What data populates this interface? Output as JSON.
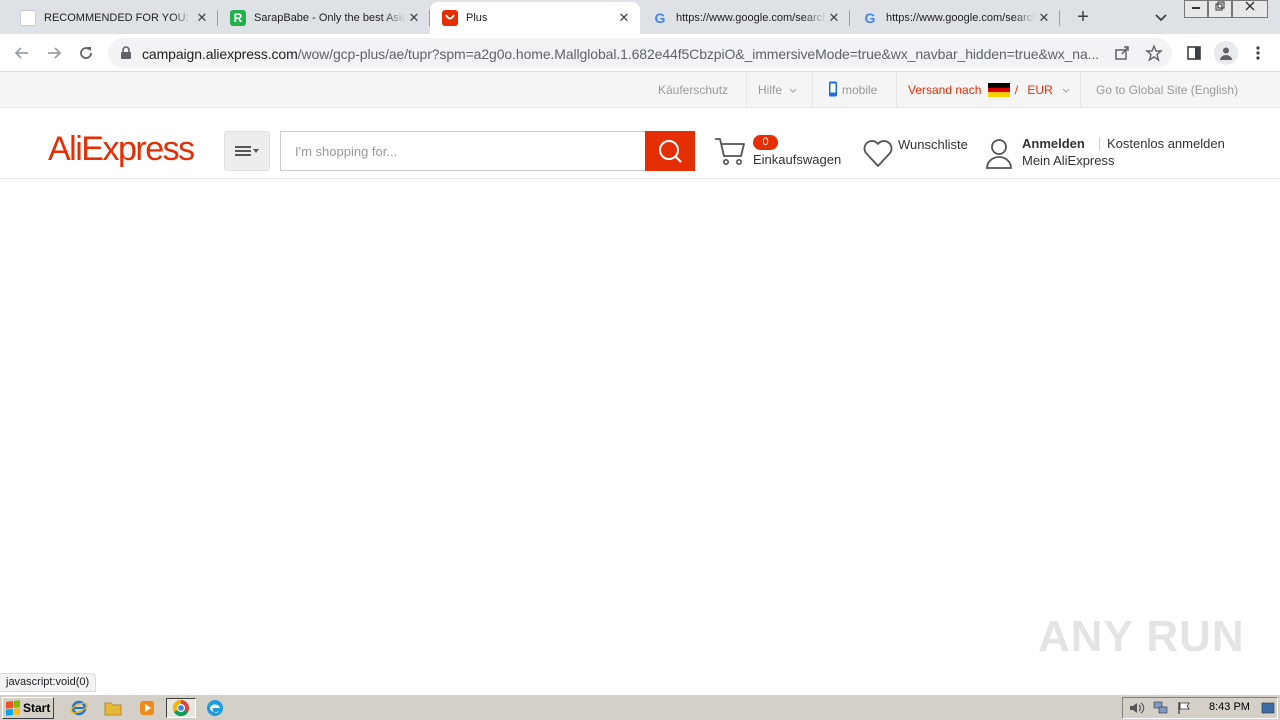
{
  "browser": {
    "tabs": [
      {
        "title": "RECOMMENDED FOR YOU:",
        "favicon": "blank-page-icon"
      },
      {
        "title": "SarapBabe - Only the best Asian",
        "favicon": "r-logo-icon"
      },
      {
        "title": "Plus",
        "favicon": "aliexpress-icon",
        "active": true
      },
      {
        "title": "https://www.google.com/search",
        "favicon": "google-icon"
      },
      {
        "title": "https://www.google.com/search",
        "favicon": "google-icon"
      }
    ],
    "close_glyph": "✕",
    "new_tab_glyph": "+",
    "url_host": "campaign.aliexpress.com",
    "url_rest": "/wow/gcp-plus/ae/tupr?spm=a2g0o.home.Mallglobal.1.682e44f5CbzpiO&_immersiveMode=true&wx_navbar_hidden=true&wx_na..."
  },
  "topbar": {
    "buyer_protection": "Käuferschutz",
    "help": "Hilfe",
    "mobile": "mobile",
    "ship_to": "Versand nach",
    "slash": "/",
    "currency": "EUR",
    "global_site": "Go to Global Site (English)"
  },
  "header": {
    "logo": "AliExpress",
    "search_placeholder": "I'm shopping for...",
    "cart_count": "0",
    "cart_label": "Einkaufswagen",
    "wishlist_label": "Wunschliste",
    "sign_in": "Anmelden",
    "register": "Kostenlos anmelden",
    "my_account": "Mein AliExpress"
  },
  "status_bar": "javascript:void(0)",
  "watermark": "ANY RUN",
  "taskbar": {
    "start_label": "Start",
    "clock": "8:43 PM"
  },
  "colors": {
    "brand": "#e62e04",
    "tab_strip": "#dee1e6",
    "taskbar": "#d4d0c8"
  }
}
